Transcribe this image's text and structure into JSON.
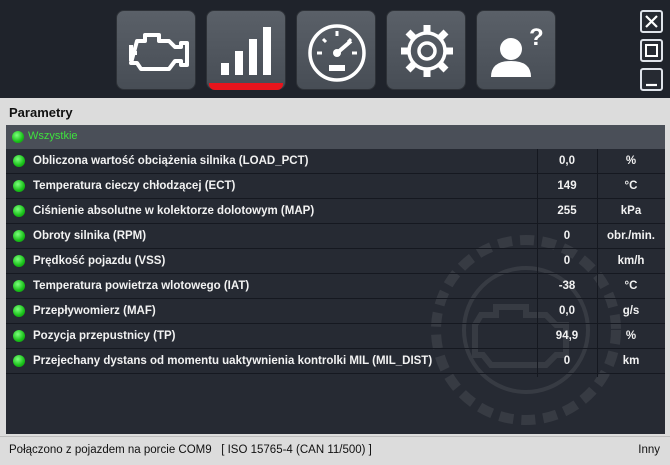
{
  "toolbar": {
    "buttons": [
      {
        "icon": "engine-icon",
        "active": false
      },
      {
        "icon": "signal-bars-icon",
        "active": true
      },
      {
        "icon": "gauge-icon",
        "active": false
      },
      {
        "icon": "gear-icon",
        "active": false
      },
      {
        "icon": "help-user-icon",
        "active": false
      }
    ],
    "active_color": "#e8141c"
  },
  "panel": {
    "title": "Parametry",
    "group": "Wszystkie",
    "rows": [
      {
        "name": "Obliczona wartość obciążenia silnika (LOAD_PCT)",
        "value": "0,0",
        "unit": "%"
      },
      {
        "name": "Temperatura cieczy chłodzącej (ECT)",
        "value": "149",
        "unit": "°C"
      },
      {
        "name": "Ciśnienie absolutne w kolektorze dolotowym (MAP)",
        "value": "255",
        "unit": "kPa"
      },
      {
        "name": "Obroty silnika (RPM)",
        "value": "0",
        "unit": "obr./min."
      },
      {
        "name": "Prędkość pojazdu (VSS)",
        "value": "0",
        "unit": "km/h"
      },
      {
        "name": "Temperatura powietrza wlotowego (IAT)",
        "value": "-38",
        "unit": "°C"
      },
      {
        "name": "Przepływomierz (MAF)",
        "value": "0,0",
        "unit": "g/s"
      },
      {
        "name": "Pozycja przepustnicy (TP)",
        "value": "94,9",
        "unit": "%"
      },
      {
        "name": "Przejechany dystans od momentu uaktywnienia kontrolki MIL (MIL_DIST)",
        "value": "0",
        "unit": "km"
      }
    ]
  },
  "status": {
    "connection": "Połączono z pojazdem na porcie COM9   [ ISO 15765-4 (CAN 11/500) ]",
    "mode": "Inny"
  },
  "colors": {
    "indicator": "#18c018",
    "group_text": "#3ee23e"
  }
}
